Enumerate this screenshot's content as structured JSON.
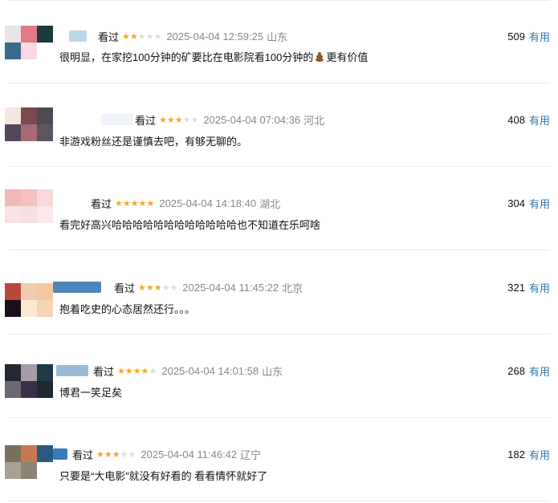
{
  "reviews": [
    {
      "status": "看过",
      "rating": 2,
      "time": "2025-04-04 12:59:25",
      "location": "山东",
      "votes": "509",
      "useful_label": "有用",
      "content_before": "很明显，在家挖100分钟的矿要比在电影院看100分钟的",
      "content_icon": "poop-icon",
      "content_after": "更有价值",
      "avatar_colors": [
        "#e9e2e8",
        "#e07a86",
        "#1d3a3c",
        "#3a6a8c",
        "#f6d7e6",
        "#ffffff"
      ],
      "name_blur_color": "#bcd6ea"
    },
    {
      "status": "看过",
      "rating": 3,
      "time": "2025-04-04 07:04:36",
      "location": "河北",
      "votes": "408",
      "useful_label": "有用",
      "content": "非游戏粉丝还是谨慎去吧，有够无聊的。",
      "avatar_colors": [
        "#f8e4e0",
        "#7a4a50",
        "#4e4a52",
        "#54465a",
        "#a86a76",
        "#5c5660"
      ],
      "name_blur_color": "#f0f4fa"
    },
    {
      "status": "看过",
      "rating": 5,
      "time": "2025-04-04 14:18:40",
      "location": "湖北",
      "votes": "304",
      "useful_label": "有用",
      "content": "看完好高兴哈哈哈哈哈哈哈哈哈哈哈哈也不知道在乐呵啥",
      "avatar_colors": [
        "#f2b8b8",
        "#f4c0c0",
        "#f8d8da",
        "#f9e2e4",
        "#f7dfe0",
        "#fbe8ea"
      ],
      "name_blur_color": "#ffffff"
    },
    {
      "status": "看过",
      "rating": 3,
      "time": "2025-04-04 11:45:22",
      "location": "北京",
      "votes": "321",
      "useful_label": "有用",
      "content": "抱着吃史的心态居然还行。。。",
      "avatar_colors": [
        "#b8483e",
        "#f0ccb0",
        "#f4c9a0",
        "#1a0f1a",
        "#fbe9d4",
        "#f8d4b2"
      ],
      "name_blur_color": "#4d86b8"
    },
    {
      "status": "看过",
      "rating": 4,
      "time": "2025-04-04 14:01:58",
      "location": "山东",
      "votes": "268",
      "useful_label": "有用",
      "content": "博君一笑足矣",
      "avatar_colors": [
        "#242832",
        "#a69ba6",
        "#1e3a44",
        "#6a6872",
        "#3a3048",
        "#202830"
      ],
      "name_blur_color": "#9bbcd8"
    },
    {
      "status": "看过",
      "rating": 3,
      "time": "2025-04-04 11:46:42",
      "location": "辽宁",
      "votes": "182",
      "useful_label": "有用",
      "content": "只要是“大电影”就没有好看的 看看情怀就好了",
      "avatar_colors": [
        "#7a7060",
        "#c87850",
        "#2a5a80",
        "#a8a090",
        "#8a8474",
        "#ffffff"
      ],
      "name_blur_color": "#3a7ab8"
    }
  ]
}
